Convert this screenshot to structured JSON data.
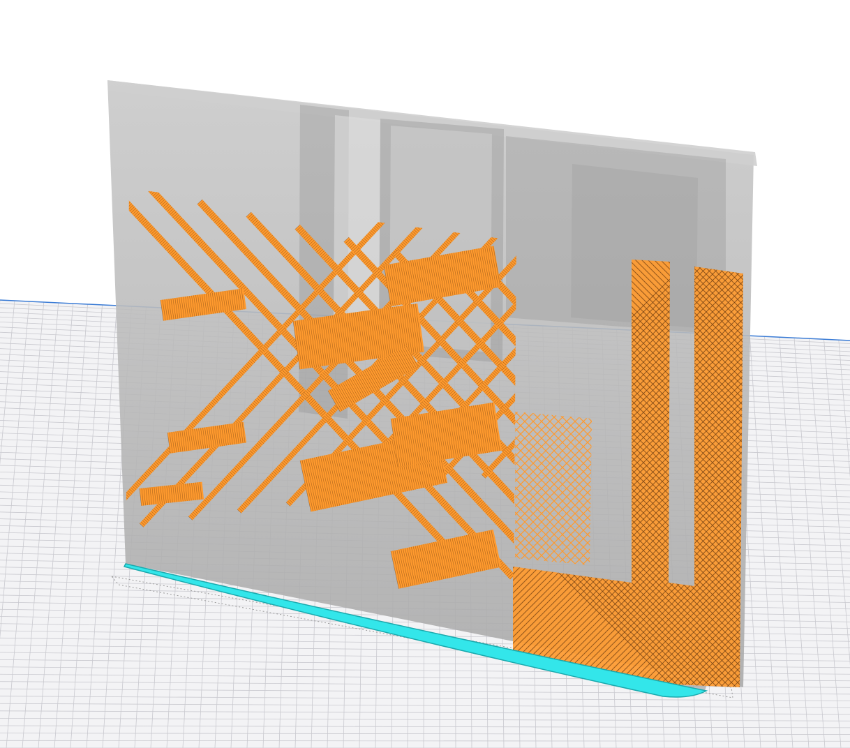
{
  "viewport": {
    "background_color": "#ffffff",
    "build_plate_color": "#f3f3f5",
    "grid_line_color": "#c9c9cf",
    "plate_edge_color": "#3a7bd5"
  },
  "model": {
    "shell_color": "#b9b9b9",
    "infill_color": "#ff9a2e",
    "infill_shadow_color": "#6a3b10",
    "skirt_color": "#33e6ea"
  }
}
